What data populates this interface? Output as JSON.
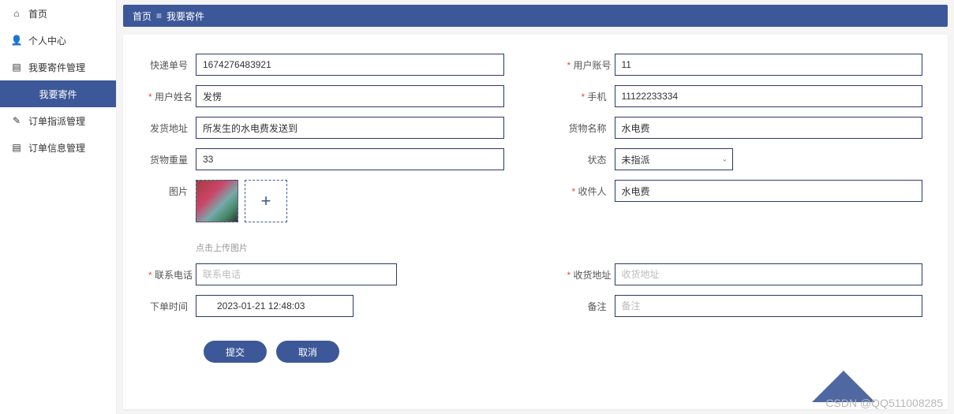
{
  "sidebar": {
    "items": [
      {
        "label": "首页",
        "icon": "⌂"
      },
      {
        "label": "个人中心",
        "icon": "👤"
      },
      {
        "label": "我要寄件管理",
        "icon": "▤"
      },
      {
        "label": "我要寄件",
        "icon": ""
      },
      {
        "label": "订单指派管理",
        "icon": "✎"
      },
      {
        "label": "订单信息管理",
        "icon": "▤"
      }
    ]
  },
  "breadcrumb": {
    "home": "首页",
    "current": "我要寄件"
  },
  "form": {
    "express_no": {
      "label": "快递单号",
      "value": "1674276483921"
    },
    "user_account": {
      "label": "用户账号",
      "value": "11"
    },
    "user_name": {
      "label": "用户姓名",
      "value": "发愣"
    },
    "phone": {
      "label": "手机",
      "value": "11122233334"
    },
    "ship_addr": {
      "label": "发货地址",
      "value": "所发生的水电费发送到"
    },
    "goods_name": {
      "label": "货物名称",
      "value": "水电费"
    },
    "goods_weight": {
      "label": "货物重量",
      "value": "33"
    },
    "status": {
      "label": "状态",
      "value": "未指派"
    },
    "image": {
      "label": "图片",
      "hint": "点击上传图片"
    },
    "receiver": {
      "label": "收件人",
      "value": "水电费"
    },
    "contact_phone": {
      "label": "联系电话",
      "placeholder": "联系电话"
    },
    "recv_addr": {
      "label": "收货地址",
      "placeholder": "收货地址"
    },
    "order_time": {
      "label": "下单时间",
      "value": "2023-01-21 12:48:03"
    },
    "remark": {
      "label": "备注",
      "placeholder": "备注"
    }
  },
  "buttons": {
    "submit": "提交",
    "cancel": "取消"
  },
  "watermark": "CSDN @QQ511008285"
}
